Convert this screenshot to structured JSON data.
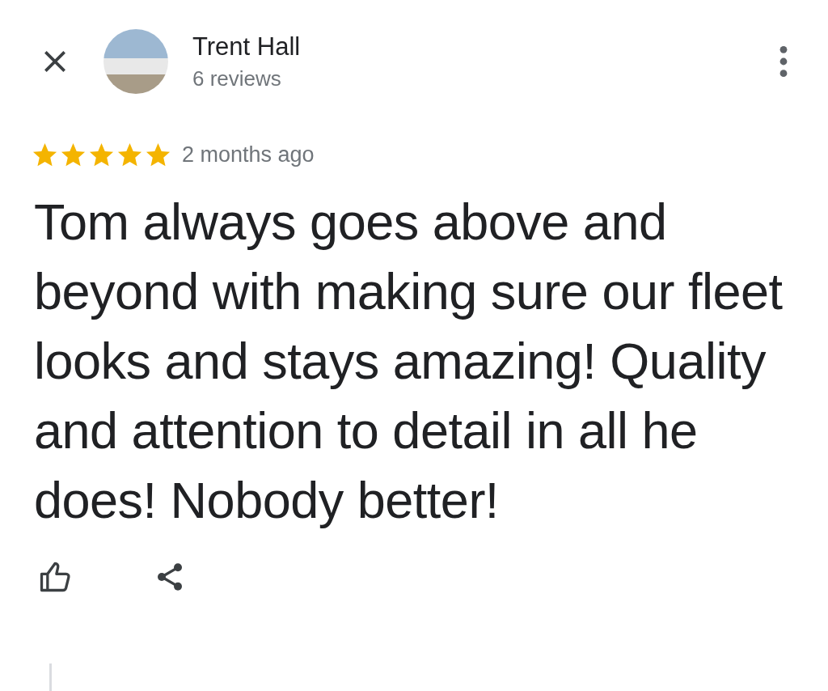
{
  "reviewer": {
    "name": "Trent Hall",
    "reviews": "6 reviews"
  },
  "review": {
    "stars": 5,
    "time": "2 months ago",
    "text": "Tom always goes above and beyond with making sure our fleet looks and stays amazing! Quality and attention to detail in all he does! Nobody better!"
  }
}
